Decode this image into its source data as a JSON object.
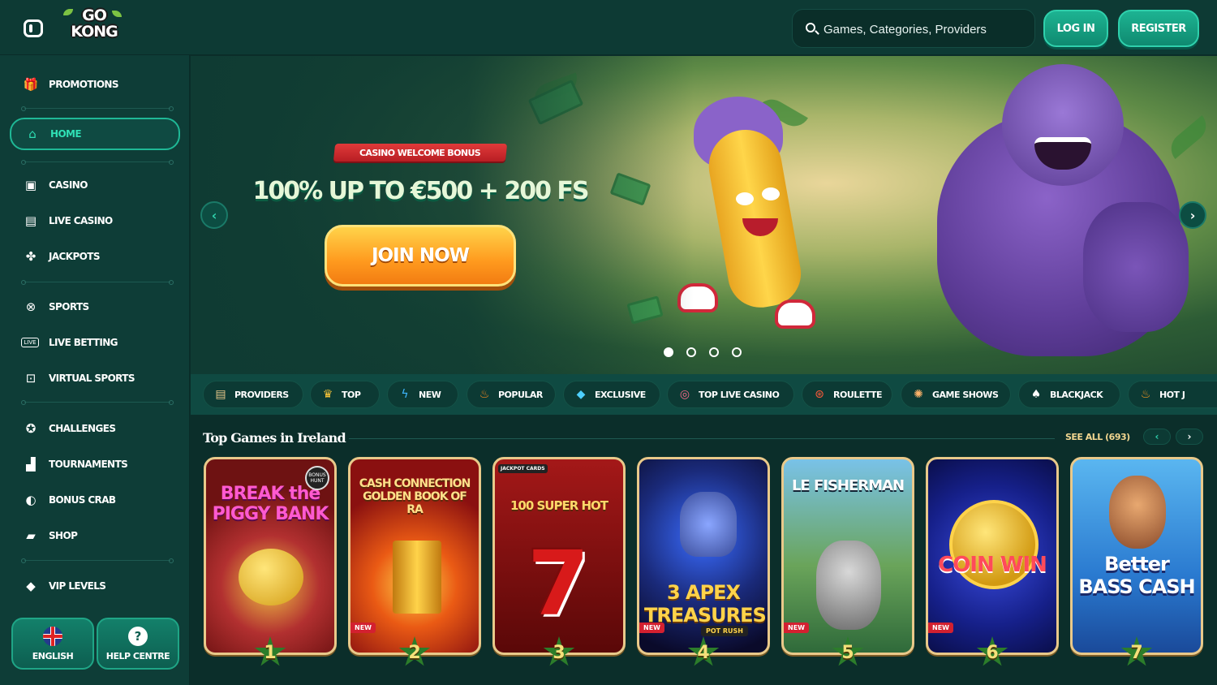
{
  "header": {
    "logo_top": "GO",
    "logo_bottom": "KONG",
    "search_placeholder": "Games, Categories, Providers",
    "login_label": "LOG IN",
    "register_label": "REGISTER"
  },
  "sidebar": {
    "items": [
      {
        "label": "PROMOTIONS",
        "icon": "gift-icon"
      },
      {
        "label": "HOME",
        "icon": "home-icon",
        "active": true
      },
      {
        "label": "CASINO",
        "icon": "slot-machine-icon"
      },
      {
        "label": "LIVE CASINO",
        "icon": "live-dealer-icon"
      },
      {
        "label": "JACKPOTS",
        "icon": "clover-icon"
      },
      {
        "label": "SPORTS",
        "icon": "ball-icon"
      },
      {
        "label": "LIVE BETTING",
        "icon": "live-badge-icon"
      },
      {
        "label": "VIRTUAL SPORTS",
        "icon": "virtual-sports-icon"
      },
      {
        "label": "CHALLENGES",
        "icon": "medal-icon"
      },
      {
        "label": "TOURNAMENTS",
        "icon": "podium-icon"
      },
      {
        "label": "BONUS CRAB",
        "icon": "crab-claw-icon"
      },
      {
        "label": "SHOP",
        "icon": "basket-icon"
      },
      {
        "label": "VIP LEVELS",
        "icon": "diamond-icon"
      }
    ],
    "language_label": "ENGLISH",
    "help_label": "HELP CENTRE"
  },
  "banner": {
    "tag": "CASINO WELCOME BONUS",
    "title": "100% UP TO €500 + 200 FS",
    "cta": "JOIN NOW",
    "slides_total": 4,
    "active_slide": 1
  },
  "categories": [
    {
      "label": "PROVIDERS",
      "icon": "scroll-icon"
    },
    {
      "label": "TOP",
      "icon": "crown-icon"
    },
    {
      "label": "NEW",
      "icon": "lightning-icon"
    },
    {
      "label": "POPULAR",
      "icon": "fire-icon"
    },
    {
      "label": "EXCLUSIVE",
      "icon": "gem-icon"
    },
    {
      "label": "TOP LIVE CASINO",
      "icon": "chip-icon"
    },
    {
      "label": "ROULETTE",
      "icon": "roulette-icon"
    },
    {
      "label": "GAME SHOWS",
      "icon": "wheel-icon"
    },
    {
      "label": "BLACKJACK",
      "icon": "cards-icon"
    },
    {
      "label": "HOT J",
      "icon": "hot-icon"
    }
  ],
  "top_games": {
    "title": "Top Games in Ireland",
    "see_all": "SEE ALL (693)",
    "games": [
      {
        "rank": "1",
        "title": "BREAK the PIGGY BANK",
        "badge": "BONUS HUNT",
        "new": false
      },
      {
        "rank": "2",
        "title": "CASH CONNECTION GOLDEN BOOK OF RA",
        "new": true
      },
      {
        "rank": "3",
        "title": "100 SUPER HOT",
        "badge": "JACKPOT CARDS",
        "new": false
      },
      {
        "rank": "4",
        "title": "3 APEX TREASURES",
        "badge": "POT RUSH",
        "new": true
      },
      {
        "rank": "5",
        "title": "LE FISHERMAN",
        "new": true
      },
      {
        "rank": "6",
        "title": "COIN WIN",
        "new": true
      },
      {
        "rank": "7",
        "title": "Better BASS CASH",
        "new": false
      }
    ],
    "new_label": "NEW"
  }
}
